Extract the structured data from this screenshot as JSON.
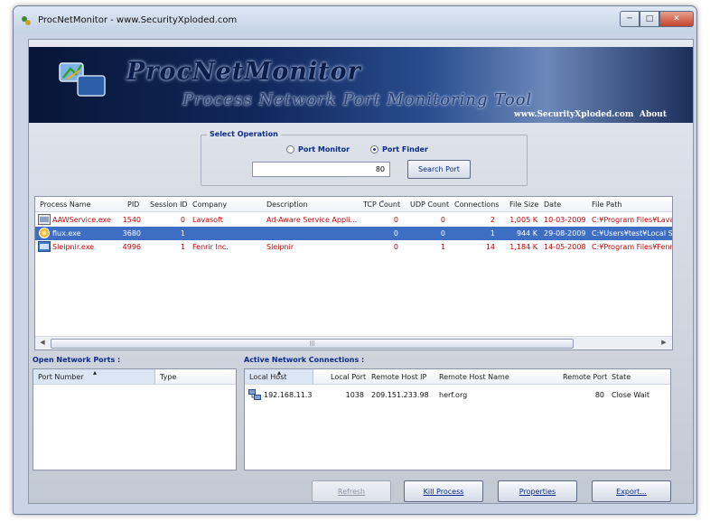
{
  "window": {
    "title": "ProcNetMonitor - www.SecurityXploded.com",
    "min_glyph": "─",
    "max_glyph": "□",
    "close_glyph": "✕"
  },
  "banner": {
    "title": "ProcNetMonitor",
    "subtitle": "Process Network Port Monitoring Tool",
    "site_link": "www.SecurityXploded.com",
    "about_link": "About"
  },
  "operation": {
    "legend": "Select Operation",
    "mode_port_monitor": "Port Monitor",
    "mode_port_finder": "Port Finder",
    "selected_mode": "Port Finder",
    "port_value": "80",
    "search_button": "Search Port"
  },
  "process_table": {
    "columns": [
      "Process Name",
      "PID",
      "Session ID",
      "Company",
      "Description",
      "TCP Count",
      "UDP Count",
      "Connections",
      "File Size",
      "Date",
      "File Path"
    ],
    "sorted_column": "TCP Count",
    "rows": [
      {
        "name": "AAWService.exe",
        "pid": "1540",
        "session": "0",
        "company": "Lavasoft",
        "description": "Ad-Aware Service Appli...",
        "tcp": "0",
        "udp": "0",
        "connections": "2",
        "size": "1,005 K",
        "date": "10-03-2009",
        "path": "C:¥Program Files¥Lavaso",
        "icon": "service-icon",
        "selected": false
      },
      {
        "name": "flux.exe",
        "pid": "3680",
        "session": "1",
        "company": "",
        "description": "",
        "tcp": "0",
        "udp": "0",
        "connections": "1",
        "size": "944 K",
        "date": "29-08-2009",
        "path": "C:¥Users¥test¥Local Set",
        "icon": "flux-icon",
        "selected": true
      },
      {
        "name": "Sleipnir.exe",
        "pid": "4996",
        "session": "1",
        "company": "Fenrir Inc.",
        "description": "Sleipnir",
        "tcp": "0",
        "udp": "1",
        "connections": "14",
        "size": "1,184 K",
        "date": "14-05-2008",
        "path": "C:¥Program Files¥Fenrir &",
        "icon": "browser-icon",
        "selected": false
      }
    ],
    "scroll_grip": "|||"
  },
  "open_ports": {
    "label": "Open Network Ports :",
    "columns": [
      "Port Number",
      "Type"
    ],
    "rows": []
  },
  "connections": {
    "label": "Active Network Connections :",
    "columns": [
      "Local Host",
      "Local Port",
      "Remote Host IP",
      "Remote Host Name",
      "Remote Port",
      "State"
    ],
    "rows": [
      {
        "local_host": "192.168.11.3",
        "local_port": "1038",
        "remote_ip": "209.151.233.98",
        "remote_name": "herf.org",
        "remote_port": "80",
        "state": "Close Wait"
      }
    ]
  },
  "buttons": {
    "refresh": "Refresh",
    "kill": "Kill Process",
    "properties": "Properties",
    "export": "Export..."
  },
  "colors": {
    "active_process_text": "#d10000",
    "selection": "#3e6ec4",
    "label_blue": "#0a2a8a"
  }
}
